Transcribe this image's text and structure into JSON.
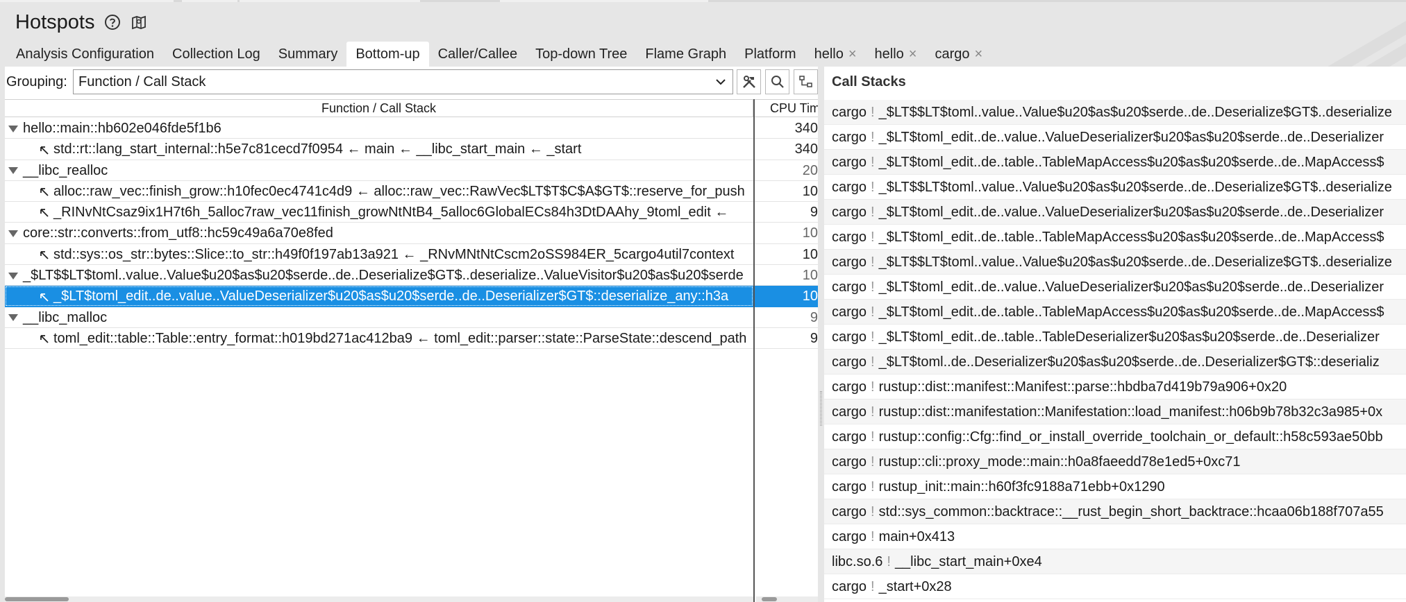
{
  "app": {
    "title": "Hotspots",
    "help_icon": "help-circle-icon",
    "map_icon": "map-icon"
  },
  "tabs": [
    {
      "label": "Analysis Configuration",
      "closable": false,
      "active": false
    },
    {
      "label": "Collection Log",
      "closable": false,
      "active": false
    },
    {
      "label": "Summary",
      "closable": false,
      "active": false
    },
    {
      "label": "Bottom-up",
      "closable": false,
      "active": true
    },
    {
      "label": "Caller/Callee",
      "closable": false,
      "active": false
    },
    {
      "label": "Top-down Tree",
      "closable": false,
      "active": false
    },
    {
      "label": "Flame Graph",
      "closable": false,
      "active": false
    },
    {
      "label": "Platform",
      "closable": false,
      "active": false
    },
    {
      "label": "hello",
      "closable": true,
      "active": false
    },
    {
      "label": "hello",
      "closable": true,
      "active": false
    },
    {
      "label": "cargo",
      "closable": true,
      "active": false
    }
  ],
  "tab_close_glyph": "×",
  "grouping": {
    "label": "Grouping:",
    "value": "Function / Call Stack"
  },
  "grid": {
    "col_function": "Function / Call Stack",
    "col_cpu": "CPU Time",
    "rows": [
      {
        "level": 0,
        "text": "hello::main::hb602e046fde5f1b6",
        "cpu": "340",
        "selected": false
      },
      {
        "level": 1,
        "text": "std::rt::lang_start_internal::h5e7c81cecd7f0954 ← main ← __libc_start_main ← _start",
        "cpu": "340",
        "selected": false
      },
      {
        "level": 0,
        "text": "__libc_realloc",
        "cpu": "20",
        "selected": false
      },
      {
        "level": 1,
        "text": "alloc::raw_vec::finish_grow::h10fec0ec4741c4d9 ← alloc::raw_vec::RawVec$LT$T$C$A$GT$::reserve_for_push",
        "cpu": "10",
        "selected": false
      },
      {
        "level": 1,
        "text": "_RINvNtCsaz9ix1H7t6h_5alloc7raw_vec11finish_growNtNtB4_5alloc6GlobalECs84h3DtDAAhy_9toml_edit ← ",
        "cpu": "9",
        "selected": false
      },
      {
        "level": 0,
        "text": "core::str::converts::from_utf8::hc59c49a6a70e8fed",
        "cpu": "10",
        "selected": false
      },
      {
        "level": 1,
        "text": "std::sys::os_str::bytes::Slice::to_str::h49f0f197ab13a921 ← _RNvMNtNtCscm2oSS984ER_5cargo4util7context",
        "cpu": "10",
        "selected": false
      },
      {
        "level": 0,
        "text": "_$LT$$LT$toml..value..Value$u20$as$u20$serde..de..Deserialize$GT$..deserialize..ValueVisitor$u20$as$u20$serde",
        "cpu": "10",
        "selected": false
      },
      {
        "level": 1,
        "text": "_$LT$toml_edit..de..value..ValueDeserializer$u20$as$u20$serde..de..Deserializer$GT$::deserialize_any::h3a",
        "cpu": "10",
        "selected": true
      },
      {
        "level": 0,
        "text": "__libc_malloc",
        "cpu": "9",
        "selected": false
      },
      {
        "level": 1,
        "text": "toml_edit::table::Table::entry_format::h019bd271ac412ba9 ← toml_edit::parser::state::ParseState::descend_path",
        "cpu": "9",
        "selected": false
      }
    ]
  },
  "call_stacks": {
    "title": "Call Stacks",
    "items": [
      {
        "module": "cargo",
        "frame": "_$LT$$LT$toml..value..Value$u20$as$u20$serde..de..Deserialize$GT$..deserialize"
      },
      {
        "module": "cargo",
        "frame": "_$LT$toml_edit..de..value..ValueDeserializer$u20$as$u20$serde..de..Deserializer"
      },
      {
        "module": "cargo",
        "frame": "_$LT$toml_edit..de..table..TableMapAccess$u20$as$u20$serde..de..MapAccess$"
      },
      {
        "module": "cargo",
        "frame": "_$LT$$LT$toml..value..Value$u20$as$u20$serde..de..Deserialize$GT$..deserialize"
      },
      {
        "module": "cargo",
        "frame": "_$LT$toml_edit..de..value..ValueDeserializer$u20$as$u20$serde..de..Deserializer"
      },
      {
        "module": "cargo",
        "frame": "_$LT$toml_edit..de..table..TableMapAccess$u20$as$u20$serde..de..MapAccess$"
      },
      {
        "module": "cargo",
        "frame": "_$LT$$LT$toml..value..Value$u20$as$u20$serde..de..Deserialize$GT$..deserialize"
      },
      {
        "module": "cargo",
        "frame": "_$LT$toml_edit..de..value..ValueDeserializer$u20$as$u20$serde..de..Deserializer"
      },
      {
        "module": "cargo",
        "frame": "_$LT$toml_edit..de..table..TableMapAccess$u20$as$u20$serde..de..MapAccess$"
      },
      {
        "module": "cargo",
        "frame": "_$LT$toml_edit..de..table..TableDeserializer$u20$as$u20$serde..de..Deserializer"
      },
      {
        "module": "cargo",
        "frame": "_$LT$toml..de..Deserializer$u20$as$u20$serde..de..Deserializer$GT$::deserializ"
      },
      {
        "module": "cargo",
        "frame": "rustup::dist::manifest::Manifest::parse::hbdba7d419b79a906+0x20"
      },
      {
        "module": "cargo",
        "frame": "rustup::dist::manifestation::Manifestation::load_manifest::h06b9b78b32c3a985+0x"
      },
      {
        "module": "cargo",
        "frame": "rustup::config::Cfg::find_or_install_override_toolchain_or_default::h58c593ae50bb"
      },
      {
        "module": "cargo",
        "frame": "rustup::cli::proxy_mode::main::h0a8faeedd78e1ed5+0xc71"
      },
      {
        "module": "cargo",
        "frame": "rustup_init::main::h60f3fc9188a71ebb+0x1290"
      },
      {
        "module": "cargo",
        "frame": "std::sys_common::backtrace::__rust_begin_short_backtrace::hcaa06b188f707a55"
      },
      {
        "module": "cargo",
        "frame": "main+0x413"
      },
      {
        "module": "libc.so.6",
        "frame": "__libc_start_main+0xe4"
      },
      {
        "module": "cargo",
        "frame": "_start+0x28"
      }
    ],
    "separator": "!"
  },
  "colors": {
    "selection": "#1a8fe3",
    "background": "#e6e6e6",
    "panel": "#ffffff"
  }
}
